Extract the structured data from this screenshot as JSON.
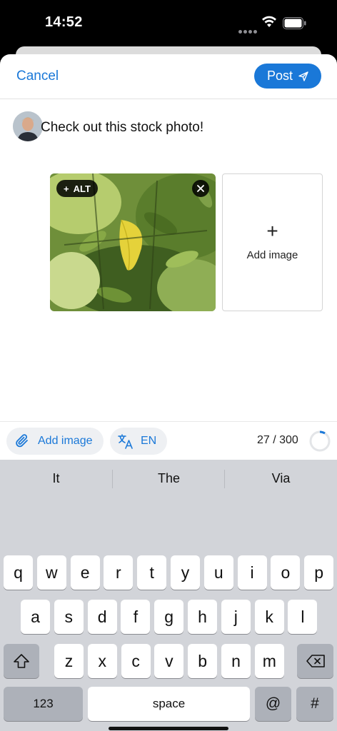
{
  "status_bar": {
    "time": "14:52"
  },
  "nav": {
    "cancel_label": "Cancel",
    "post_label": "Post"
  },
  "composer": {
    "text": "Check out this stock photo!"
  },
  "media": {
    "alt_label": "ALT",
    "add_image_label": "Add image"
  },
  "toolbar": {
    "add_image_label": "Add image",
    "language_label": "EN",
    "char_count": "27 / 300",
    "char_progress_fraction": 0.09
  },
  "keyboard": {
    "suggestions": [
      "It",
      "The",
      "Via"
    ],
    "row1": [
      "q",
      "w",
      "e",
      "r",
      "t",
      "y",
      "u",
      "i",
      "o",
      "p"
    ],
    "row2": [
      "a",
      "s",
      "d",
      "f",
      "g",
      "h",
      "j",
      "k",
      "l"
    ],
    "row3": [
      "z",
      "x",
      "c",
      "v",
      "b",
      "n",
      "m"
    ],
    "numbers_label": "123",
    "space_label": "space",
    "at_label": "@",
    "hash_label": "#"
  },
  "colors": {
    "accent": "#1a78d8",
    "keyboard_bg": "#d2d4d9"
  },
  "icons": [
    "wifi-icon",
    "battery-icon",
    "send-icon",
    "plus-icon",
    "close-icon",
    "paperclip-icon",
    "translate-icon",
    "shift-icon",
    "backspace-icon",
    "emoji-icon",
    "microphone-icon"
  ]
}
